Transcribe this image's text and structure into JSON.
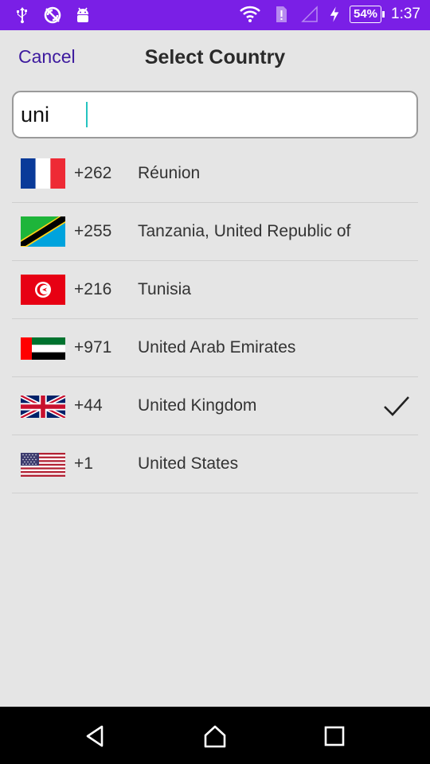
{
  "status_bar": {
    "battery": "54%",
    "time": "1:37",
    "icons": [
      "usb-icon",
      "sync-off-icon",
      "android-icon",
      "wifi-icon",
      "sim-alert-icon",
      "signal-icon",
      "charging-icon"
    ]
  },
  "header": {
    "cancel_label": "Cancel",
    "title": "Select Country"
  },
  "search": {
    "value": "uni"
  },
  "countries": [
    {
      "flag": "flag-france-icon",
      "code": "+262",
      "name": "Réunion",
      "selected": false
    },
    {
      "flag": "flag-tanzania-icon",
      "code": "+255",
      "name": "Tanzania, United Republic of",
      "selected": false
    },
    {
      "flag": "flag-tunisia-icon",
      "code": "+216",
      "name": "Tunisia",
      "selected": false
    },
    {
      "flag": "flag-uae-icon",
      "code": "+971",
      "name": "United Arab Emirates",
      "selected": false
    },
    {
      "flag": "flag-uk-icon",
      "code": "+44",
      "name": "United Kingdom",
      "selected": true
    },
    {
      "flag": "flag-us-icon",
      "code": "+1",
      "name": "United States",
      "selected": false
    }
  ],
  "colors": {
    "status_bar": "#7a1fe6",
    "cancel": "#3d1a9e",
    "background": "#e5e5e5",
    "caret": "#25c4c0"
  },
  "nav": {
    "icons": [
      "back-icon",
      "home-icon",
      "recents-icon"
    ]
  }
}
